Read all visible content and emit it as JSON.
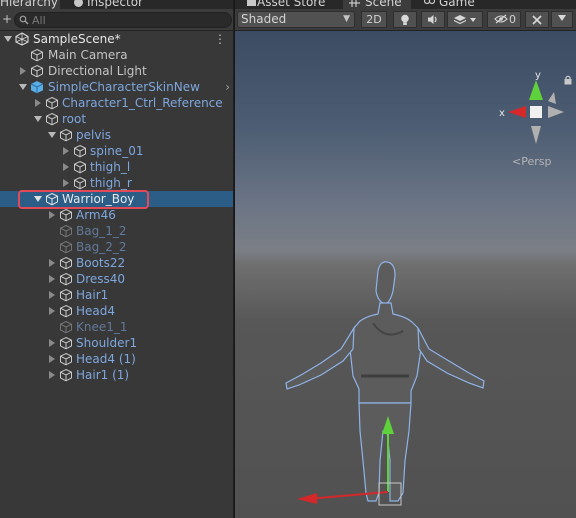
{
  "hierarchy": {
    "tab_label": "Hierarchy",
    "inspector_tab_label": "Inspector",
    "add_button": "+",
    "search_placeholder": "All",
    "scene_name": "SampleScene*",
    "menu_glyph": "⋮",
    "items": [
      {
        "label": "Main Camera"
      },
      {
        "label": "Directional Light"
      },
      {
        "label": "SimpleCharacterSkinNew"
      },
      {
        "label": "Character1_Ctrl_Reference"
      },
      {
        "label": "root"
      },
      {
        "label": "pelvis"
      },
      {
        "label": "spine_01"
      },
      {
        "label": "thigh_l"
      },
      {
        "label": "thigh_r"
      },
      {
        "label": "Warrior_Boy"
      },
      {
        "label": "Arm46"
      },
      {
        "label": "Bag_1_2"
      },
      {
        "label": "Bag_2_2"
      },
      {
        "label": "Boots22"
      },
      {
        "label": "Dress40"
      },
      {
        "label": "Hair1"
      },
      {
        "label": "Head4"
      },
      {
        "label": "Knee1_1"
      },
      {
        "label": "Shoulder1"
      },
      {
        "label": "Head4 (1)"
      },
      {
        "label": "Hair1 (1)"
      }
    ]
  },
  "scene": {
    "tabs": {
      "asset_store": "Asset Store",
      "scene": "Scene",
      "game": "Game"
    },
    "shading_mode": "Shaded",
    "mode_2d": "2D",
    "hidden_count": "0",
    "projection_label": "<Persp",
    "axis_y": "y",
    "axis_x": "x"
  },
  "colors": {
    "selection": "#2c5d87",
    "highlight_box": "#e24a5a",
    "prefab_blue": "#7ea7de",
    "inactive_blue": "#62799a",
    "axis_y_green": "#5fd13a",
    "axis_x_red": "#d4282a"
  }
}
